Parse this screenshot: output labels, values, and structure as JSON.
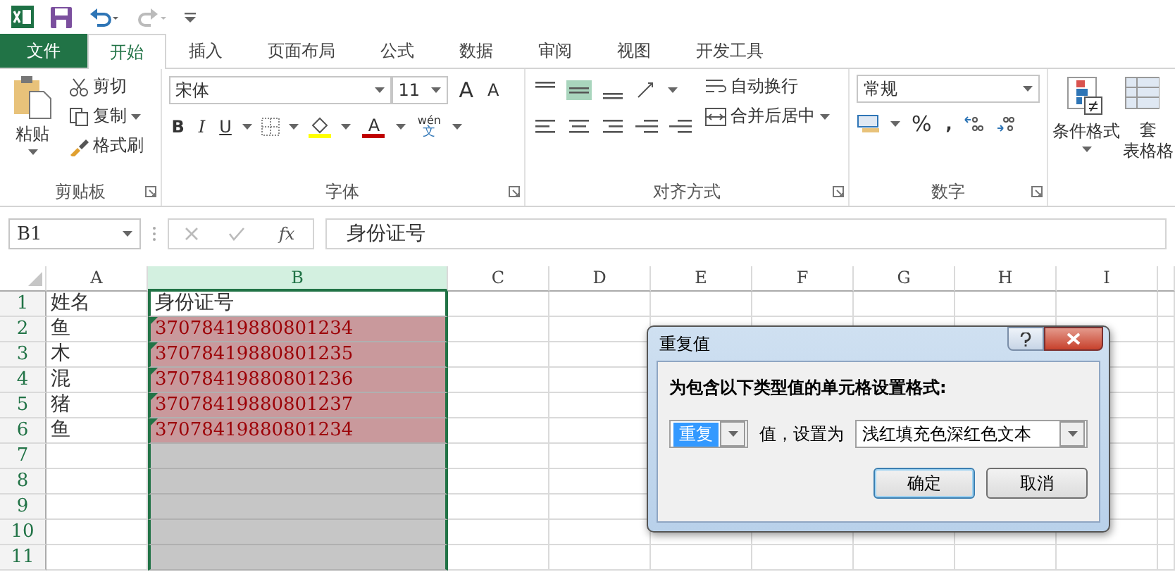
{
  "tabs": [
    {
      "label": "文件",
      "kind": "file",
      "selected": false
    },
    {
      "label": "开始",
      "kind": "tab",
      "selected": true
    },
    {
      "label": "插入",
      "kind": "tab",
      "selected": false
    },
    {
      "label": "页面布局",
      "kind": "tab",
      "selected": false
    },
    {
      "label": "公式",
      "kind": "tab",
      "selected": false
    },
    {
      "label": "数据",
      "kind": "tab",
      "selected": false
    },
    {
      "label": "审阅",
      "kind": "tab",
      "selected": false
    },
    {
      "label": "视图",
      "kind": "tab",
      "selected": false
    },
    {
      "label": "开发工具",
      "kind": "tab",
      "selected": false
    }
  ],
  "ribbon": {
    "clipboard": {
      "paste": "粘贴",
      "cut": "剪切",
      "copy": "复制",
      "format_painter": "格式刷",
      "label": "剪贴板"
    },
    "font": {
      "name": "宋体",
      "size": "11",
      "grow": "A",
      "shrink": "A",
      "bold": "B",
      "italic": "I",
      "underline": "U",
      "font_color": "A",
      "phonetic_top": "wén",
      "phonetic_bottom": "文",
      "label": "字体"
    },
    "alignment": {
      "wrap": "自动换行",
      "merge": "合并后居中",
      "label": "对齐方式"
    },
    "number": {
      "format": "常规",
      "percent": "%",
      "comma": ",",
      "label": "数字"
    },
    "styles": {
      "conditional": "条件格式",
      "table_top": "套",
      "table_bottom": "表格格"
    }
  },
  "formula_bar": {
    "name_box": "B1",
    "fx": "fx",
    "formula": "身份证号"
  },
  "columns": [
    {
      "label": "A",
      "selected": false
    },
    {
      "label": "B",
      "selected": true
    },
    {
      "label": "C",
      "selected": false
    },
    {
      "label": "D",
      "selected": false
    },
    {
      "label": "E",
      "selected": false
    },
    {
      "label": "F",
      "selected": false
    },
    {
      "label": "G",
      "selected": false
    },
    {
      "label": "H",
      "selected": false
    },
    {
      "label": "I",
      "selected": false
    }
  ],
  "rows": [
    {
      "number": "1",
      "name": "姓名",
      "id": "身份证号",
      "active": true,
      "highlighted": false,
      "error_marker": false
    },
    {
      "number": "2",
      "name": "鱼",
      "id": "37078419880801234",
      "active": false,
      "highlighted": true,
      "error_marker": true
    },
    {
      "number": "3",
      "name": "木",
      "id": "37078419880801235",
      "active": false,
      "highlighted": true,
      "error_marker": true
    },
    {
      "number": "4",
      "name": "混",
      "id": "37078419880801236",
      "active": false,
      "highlighted": true,
      "error_marker": true
    },
    {
      "number": "5",
      "name": "猪",
      "id": "37078419880801237",
      "active": false,
      "highlighted": true,
      "error_marker": true
    },
    {
      "number": "6",
      "name": "鱼",
      "id": "37078419880801234",
      "active": false,
      "highlighted": true,
      "error_marker": true
    },
    {
      "number": "7",
      "active": false,
      "highlighted": false,
      "error_marker": false
    },
    {
      "number": "8",
      "active": false,
      "highlighted": false,
      "error_marker": false
    },
    {
      "number": "9",
      "active": false,
      "highlighted": false,
      "error_marker": false
    },
    {
      "number": "10",
      "active": false,
      "highlighted": false,
      "error_marker": false
    },
    {
      "number": "11",
      "active": false,
      "highlighted": false,
      "error_marker": false
    }
  ],
  "dialog": {
    "title": "重复值",
    "prompt": "为包含以下类型值的单元格设置格式:",
    "rule": "重复",
    "between": "值，设置为",
    "format": "浅红填充色深红色文本",
    "buttons": [
      {
        "label": "确定",
        "default": true
      },
      {
        "label": "取消",
        "default": false
      }
    ]
  }
}
